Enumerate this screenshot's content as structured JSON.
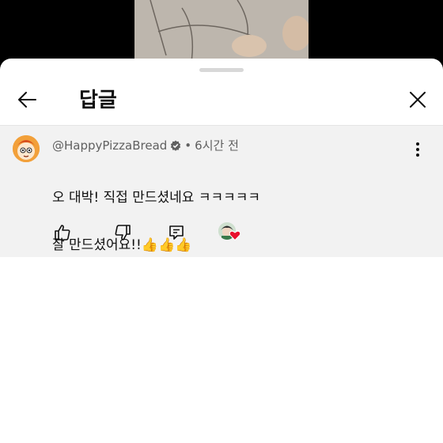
{
  "header": {
    "title": "답글"
  },
  "comment": {
    "author": "@HappyPizzaBread",
    "separator": "•",
    "timestamp": "6시간 전",
    "text_line1": "오 대박! 직접 만드셨네요 ㅋㅋㅋㅋㅋ",
    "text_line2": "잘 만드셨어요!!👍👍👍"
  },
  "icons": {
    "back": "arrow-left-icon",
    "close": "close-icon",
    "more": "more-vert-icon",
    "like": "thumbs-up-icon",
    "dislike": "thumbs-down-icon",
    "reply": "reply-comment-icon",
    "creator_heart": "creator-heart-icon",
    "verified": "verified-badge-icon"
  },
  "colors": {
    "heart": "#e8112d",
    "comment_bg": "#f2f2f2",
    "text": "#0f0f0f",
    "meta": "#606060"
  }
}
